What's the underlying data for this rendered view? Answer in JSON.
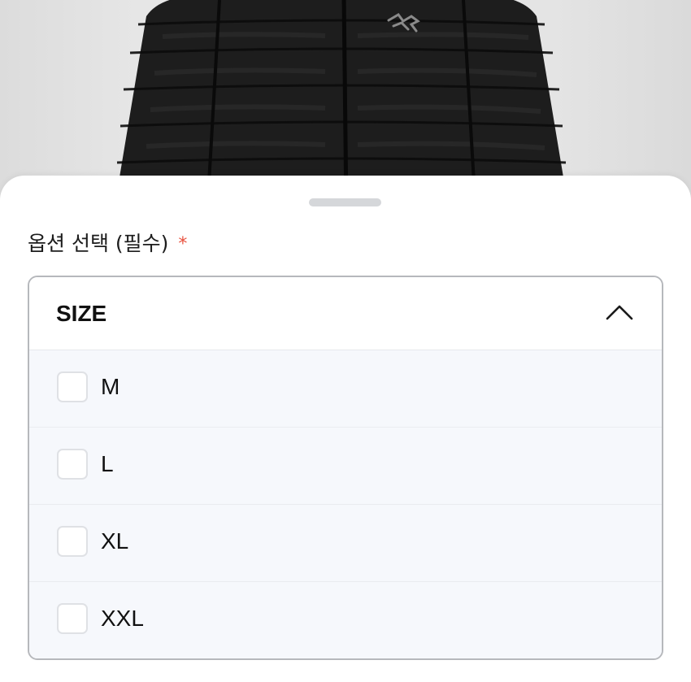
{
  "background": {
    "image": "black-puffer-jacket-product-photo",
    "logo": "arcteryx-bird-logo",
    "jacket_color": "#1e1e1e"
  },
  "sheet": {
    "section_title": "옵션 선택 (필수)",
    "required_mark": "*",
    "required_color": "#e8523f"
  },
  "dropdown": {
    "title": "SIZE",
    "expanded": true,
    "toggle_icon": "chevron-up-icon",
    "options": [
      {
        "label": "M",
        "checked": false
      },
      {
        "label": "L",
        "checked": false
      },
      {
        "label": "XL",
        "checked": false
      },
      {
        "label": "XXL",
        "checked": false
      }
    ]
  }
}
